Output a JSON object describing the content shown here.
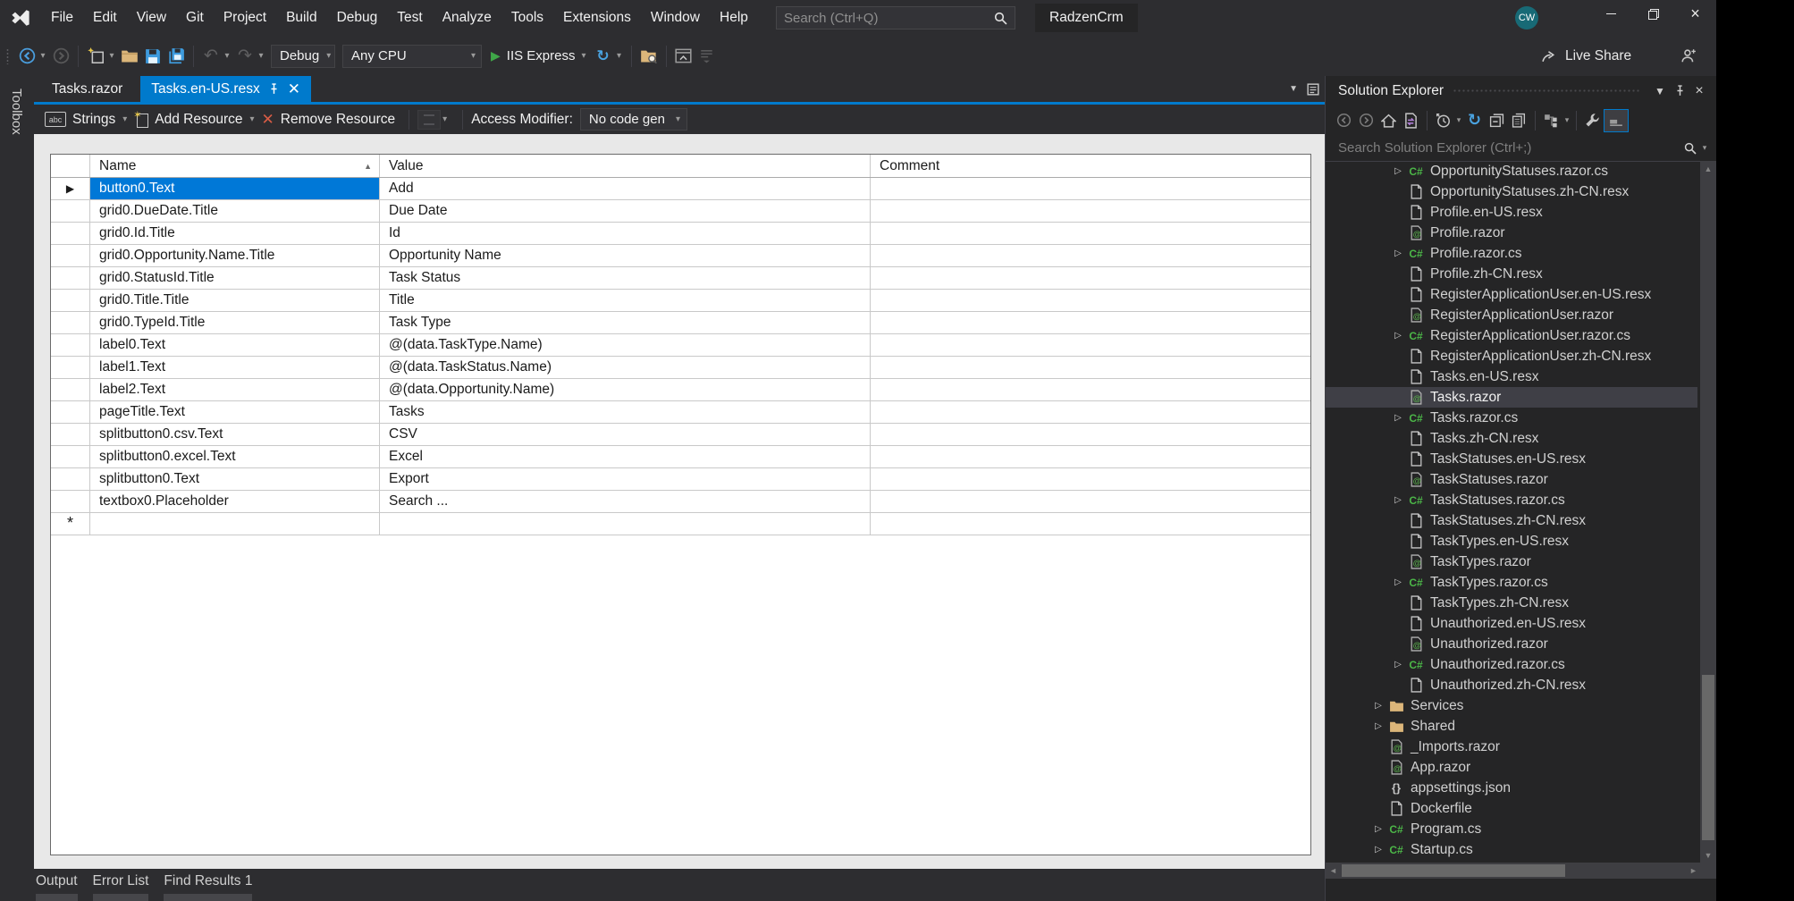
{
  "colors": {
    "accent": "#007acc",
    "selection": "#0078d7",
    "csharp_green": "#4cb648",
    "folder_tan": "#dcb67a",
    "run_green": "#3fa648",
    "remove_red": "#d85c45"
  },
  "title_bar": {
    "logo_icon": "visual-studio-logo-icon",
    "menu_items": [
      "File",
      "Edit",
      "View",
      "Git",
      "Project",
      "Build",
      "Debug",
      "Test",
      "Analyze",
      "Tools",
      "Extensions",
      "Window",
      "Help"
    ],
    "search": {
      "placeholder": "Search (Ctrl+Q)",
      "icon": "search-icon"
    },
    "project_title": "RadzenCrm",
    "avatar_text": "CW"
  },
  "main_toolbar": {
    "items": [
      {
        "kind": "icon",
        "name": "back-icon"
      },
      {
        "kind": "caret"
      },
      {
        "kind": "icon",
        "name": "forward-icon",
        "disabled": true
      },
      {
        "kind": "sep"
      },
      {
        "kind": "icon",
        "name": "new-project-icon"
      },
      {
        "kind": "caret"
      },
      {
        "kind": "icon",
        "name": "open-folder-icon"
      },
      {
        "kind": "icon",
        "name": "save-icon"
      },
      {
        "kind": "icon",
        "name": "save-all-icon"
      },
      {
        "kind": "sep"
      },
      {
        "kind": "icon",
        "name": "undo-icon",
        "disabled": true
      },
      {
        "kind": "caret"
      },
      {
        "kind": "icon",
        "name": "redo-icon",
        "disabled": true
      },
      {
        "kind": "caret"
      },
      {
        "kind": "combo",
        "name": "solution-configuration-combo",
        "value": "Debug",
        "width": 72
      },
      {
        "kind": "combo",
        "name": "solution-platform-combo",
        "value": "Any CPU",
        "width": 156
      },
      {
        "kind": "run",
        "value": "IIS Express"
      },
      {
        "kind": "icon",
        "name": "refresh-icon"
      },
      {
        "kind": "caret"
      },
      {
        "kind": "sep"
      },
      {
        "kind": "icon",
        "name": "find-in-files-icon"
      },
      {
        "kind": "sep"
      },
      {
        "kind": "icon",
        "name": "preview-window-icon"
      },
      {
        "kind": "icon",
        "name": "toolbar-overflow-icon",
        "disabled": true
      }
    ],
    "live_share_label": "Live Share"
  },
  "editor": {
    "toolbox_label": "Toolbox",
    "tabs": [
      {
        "label": "Tasks.razor",
        "active": false
      },
      {
        "label": "Tasks.en-US.resx",
        "active": true
      }
    ],
    "resx_toolbar": {
      "strings_label": "Strings",
      "add_label": "Add Resource",
      "remove_label": "Remove Resource",
      "access_label": "Access Modifier:",
      "access_value": "No code gen"
    },
    "grid": {
      "columns": [
        "Name",
        "Value",
        "Comment"
      ],
      "selected_row": 0,
      "new_row_marker": "*",
      "rows": [
        {
          "name": "button0.Text",
          "value": "Add",
          "comment": ""
        },
        {
          "name": "grid0.DueDate.Title",
          "value": "Due Date",
          "comment": ""
        },
        {
          "name": "grid0.Id.Title",
          "value": "Id",
          "comment": ""
        },
        {
          "name": "grid0.Opportunity.Name.Title",
          "value": "Opportunity Name",
          "comment": ""
        },
        {
          "name": "grid0.StatusId.Title",
          "value": "Task Status",
          "comment": ""
        },
        {
          "name": "grid0.Title.Title",
          "value": "Title",
          "comment": ""
        },
        {
          "name": "grid0.TypeId.Title",
          "value": "Task Type",
          "comment": ""
        },
        {
          "name": "label0.Text",
          "value": "@(data.TaskType.Name)",
          "comment": ""
        },
        {
          "name": "label1.Text",
          "value": "@(data.TaskStatus.Name)",
          "comment": ""
        },
        {
          "name": "label2.Text",
          "value": "@(data.Opportunity.Name)",
          "comment": ""
        },
        {
          "name": "pageTitle.Text",
          "value": "Tasks",
          "comment": ""
        },
        {
          "name": "splitbutton0.csv.Text",
          "value": "CSV",
          "comment": ""
        },
        {
          "name": "splitbutton0.excel.Text",
          "value": "Excel",
          "comment": ""
        },
        {
          "name": "splitbutton0.Text",
          "value": "Export",
          "comment": ""
        },
        {
          "name": "textbox0.Placeholder",
          "value": "Search ...",
          "comment": ""
        }
      ]
    }
  },
  "solution_explorer": {
    "title": "Solution Explorer",
    "search_placeholder": "Search Solution Explorer (Ctrl+;)",
    "toolbar": [
      {
        "kind": "icon",
        "name": "se-back-icon"
      },
      {
        "kind": "icon",
        "name": "se-forward-icon"
      },
      {
        "kind": "icon",
        "name": "home-icon"
      },
      {
        "kind": "icon",
        "name": "sync-with-active-document-icon"
      },
      {
        "kind": "sep"
      },
      {
        "kind": "icon",
        "name": "pending-changes-filter-icon"
      },
      {
        "kind": "caret"
      },
      {
        "kind": "icon",
        "name": "se-refresh-icon"
      },
      {
        "kind": "icon",
        "name": "collapse-all-icon"
      },
      {
        "kind": "icon",
        "name": "properties-icon"
      },
      {
        "kind": "sep"
      },
      {
        "kind": "icon",
        "name": "switch-views-icon"
      },
      {
        "kind": "caret"
      },
      {
        "kind": "sep"
      },
      {
        "kind": "icon",
        "name": "wrench-icon"
      },
      {
        "kind": "icon",
        "name": "preview-selected-items-icon",
        "active": true
      }
    ],
    "tree": [
      {
        "label": "OpportunityStatuses.razor.cs",
        "icon": "csharp",
        "level": 2,
        "expandable": true
      },
      {
        "label": "OpportunityStatuses.zh-CN.resx",
        "icon": "resx",
        "level": 2
      },
      {
        "label": "Profile.en-US.resx",
        "icon": "resx",
        "level": 2
      },
      {
        "label": "Profile.razor",
        "icon": "razor",
        "level": 2
      },
      {
        "label": "Profile.razor.cs",
        "icon": "csharp",
        "level": 2,
        "expandable": true
      },
      {
        "label": "Profile.zh-CN.resx",
        "icon": "resx",
        "level": 2
      },
      {
        "label": "RegisterApplicationUser.en-US.resx",
        "icon": "resx",
        "level": 2
      },
      {
        "label": "RegisterApplicationUser.razor",
        "icon": "razor",
        "level": 2
      },
      {
        "label": "RegisterApplicationUser.razor.cs",
        "icon": "csharp",
        "level": 2,
        "expandable": true
      },
      {
        "label": "RegisterApplicationUser.zh-CN.resx",
        "icon": "resx",
        "level": 2
      },
      {
        "label": "Tasks.en-US.resx",
        "icon": "resx",
        "level": 2
      },
      {
        "label": "Tasks.razor",
        "icon": "razor",
        "level": 2,
        "selected": true
      },
      {
        "label": "Tasks.razor.cs",
        "icon": "csharp",
        "level": 2,
        "expandable": true
      },
      {
        "label": "Tasks.zh-CN.resx",
        "icon": "resx",
        "level": 2
      },
      {
        "label": "TaskStatuses.en-US.resx",
        "icon": "resx",
        "level": 2
      },
      {
        "label": "TaskStatuses.razor",
        "icon": "razor",
        "level": 2
      },
      {
        "label": "TaskStatuses.razor.cs",
        "icon": "csharp",
        "level": 2,
        "expandable": true
      },
      {
        "label": "TaskStatuses.zh-CN.resx",
        "icon": "resx",
        "level": 2
      },
      {
        "label": "TaskTypes.en-US.resx",
        "icon": "resx",
        "level": 2
      },
      {
        "label": "TaskTypes.razor",
        "icon": "razor",
        "level": 2
      },
      {
        "label": "TaskTypes.razor.cs",
        "icon": "csharp",
        "level": 2,
        "expandable": true
      },
      {
        "label": "TaskTypes.zh-CN.resx",
        "icon": "resx",
        "level": 2
      },
      {
        "label": "Unauthorized.en-US.resx",
        "icon": "resx",
        "level": 2
      },
      {
        "label": "Unauthorized.razor",
        "icon": "razor",
        "level": 2
      },
      {
        "label": "Unauthorized.razor.cs",
        "icon": "csharp",
        "level": 2,
        "expandable": true
      },
      {
        "label": "Unauthorized.zh-CN.resx",
        "icon": "resx",
        "level": 2
      },
      {
        "label": "Services",
        "icon": "folder",
        "level": 1,
        "expandable": true
      },
      {
        "label": "Shared",
        "icon": "folder",
        "level": 1,
        "expandable": true
      },
      {
        "label": "_Imports.razor",
        "icon": "razor",
        "level": 1
      },
      {
        "label": "App.razor",
        "icon": "razor",
        "level": 1
      },
      {
        "label": "appsettings.json",
        "icon": "json",
        "level": 1
      },
      {
        "label": "Dockerfile",
        "icon": "file",
        "level": 1
      },
      {
        "label": "Program.cs",
        "icon": "csharp",
        "level": 1,
        "expandable": true
      },
      {
        "label": "Startup.cs",
        "icon": "csharp",
        "level": 1,
        "expandable": true
      }
    ]
  },
  "bottom_panel": {
    "tabs": [
      "Output",
      "Error List",
      "Find Results 1"
    ]
  }
}
